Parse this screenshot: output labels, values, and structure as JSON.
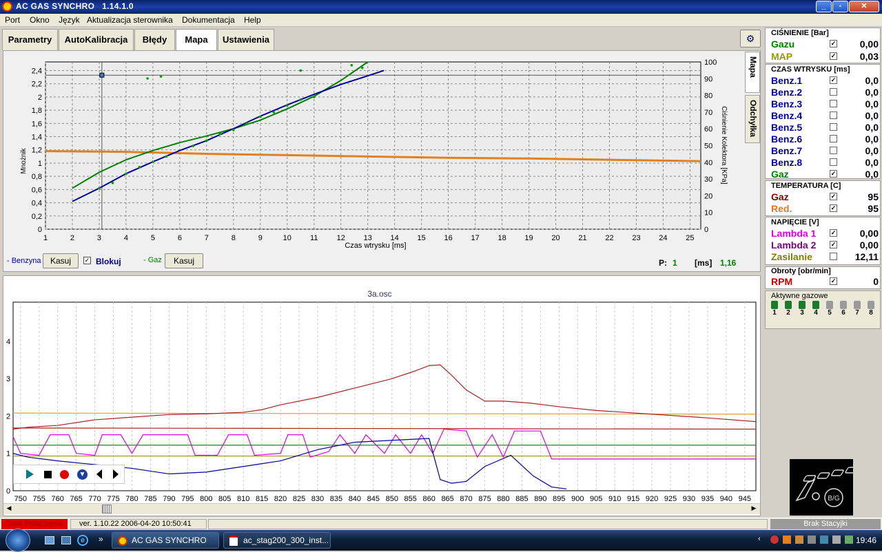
{
  "window": {
    "title": "AC GAS SYNCHRO",
    "version": "1.14.1.0"
  },
  "menu": [
    "Port",
    "Okno",
    "Język",
    "Aktualizacja sterownika",
    "Dokumentacja",
    "Help"
  ],
  "tabs": [
    "Parametry",
    "AutoKalibracja",
    "Błędy",
    "Mapa",
    "Ustawienia"
  ],
  "side_tabs": [
    "Mapa",
    "Odchyłka"
  ],
  "map_chart": {
    "xlabel": "Czas wtrysku [ms]",
    "ylabel": "Mnożnik",
    "y2label": "Ciśnienie Kolektora [KPa]",
    "x_ticks": [
      "1",
      "2",
      "3",
      "4",
      "5",
      "6",
      "7",
      "8",
      "9",
      "10",
      "11",
      "12",
      "13",
      "14",
      "15",
      "16",
      "17",
      "18",
      "19",
      "20",
      "21",
      "22",
      "23",
      "24",
      "25"
    ],
    "y_ticks": [
      "0",
      "0,2",
      "0,4",
      "0,6",
      "0,8",
      "1",
      "1,2",
      "1,4",
      "1,6",
      "1,8",
      "2",
      "2,2",
      "2,4"
    ],
    "y2_ticks": [
      "0",
      "10",
      "20",
      "30",
      "40",
      "50",
      "60",
      "70",
      "80",
      "90",
      "100"
    ]
  },
  "map_controls": {
    "benzyna_label": "- Benzyna",
    "kasuj1": "Kasuj",
    "blokuj": "Blokuj",
    "gaz_label": "- Gaz",
    "kasuj2": "Kasuj",
    "p_label": "P:",
    "p_value": "1",
    "ms_label": "[ms]",
    "ms_value": "1,16"
  },
  "osc": {
    "title": "3a.osc",
    "y_ticks": [
      "0",
      "1",
      "2",
      "3",
      "4"
    ],
    "x_ticks": [
      "750",
      "755",
      "760",
      "765",
      "770",
      "775",
      "780",
      "785",
      "790",
      "795",
      "800",
      "805",
      "810",
      "815",
      "820",
      "825",
      "830",
      "835",
      "840",
      "845",
      "850",
      "855",
      "860",
      "865",
      "870",
      "875",
      "880",
      "885",
      "890",
      "895",
      "900",
      "905",
      "910",
      "915",
      "920",
      "925",
      "930",
      "935",
      "940",
      "945"
    ]
  },
  "pressure": {
    "header": "CIŚNIENIE [Bar]",
    "rows": [
      {
        "label": "Gazu",
        "color": "#008000",
        "checked": true,
        "value": "0,00"
      },
      {
        "label": "MAP",
        "color": "#999900",
        "checked": true,
        "value": "0,03"
      }
    ]
  },
  "injection": {
    "header": "CZAS WTRYSKU  [ms]",
    "rows": [
      {
        "label": "Benz.1",
        "color": "#000099",
        "checked": true,
        "value": "0,0"
      },
      {
        "label": "Benz.2",
        "color": "#000099",
        "checked": false,
        "value": "0,0"
      },
      {
        "label": "Benz.3",
        "color": "#000099",
        "checked": false,
        "value": "0,0"
      },
      {
        "label": "Benz.4",
        "color": "#000099",
        "checked": false,
        "value": "0,0"
      },
      {
        "label": "Benz.5",
        "color": "#000099",
        "checked": false,
        "value": "0,0"
      },
      {
        "label": "Benz.6",
        "color": "#000099",
        "checked": false,
        "value": "0,0"
      },
      {
        "label": "Benz.7",
        "color": "#000099",
        "checked": false,
        "value": "0,0"
      },
      {
        "label": "Benz.8",
        "color": "#000099",
        "checked": false,
        "value": "0,0"
      },
      {
        "label": "Gaz",
        "color": "#008000",
        "checked": true,
        "value": "0,0"
      }
    ]
  },
  "temperature": {
    "header": "TEMPERATURA  [C]",
    "rows": [
      {
        "label": "Gaz",
        "color": "#800000",
        "checked": true,
        "value": "95"
      },
      {
        "label": "Red.",
        "color": "#e07820",
        "checked": true,
        "value": "95"
      }
    ]
  },
  "voltage": {
    "header": "NAPIĘCIE [V]",
    "rows": [
      {
        "label": "Lambda 1",
        "color": "#e000e0",
        "checked": true,
        "value": "0,00"
      },
      {
        "label": "Lambda 2",
        "color": "#800080",
        "checked": true,
        "value": "0,00"
      },
      {
        "label": "Zasilanie",
        "color": "#808000",
        "checked": false,
        "value": "12,11"
      }
    ]
  },
  "rpm": {
    "header": "Obroty [obr/min]",
    "rows": [
      {
        "label": "RPM",
        "color": "#cc0000",
        "checked": true,
        "value": "0"
      }
    ]
  },
  "active_gas": {
    "header": "Aktywne gazowe",
    "numbers": [
      "1",
      "2",
      "3",
      "4",
      "5",
      "6",
      "7",
      "8"
    ]
  },
  "logo": {
    "text": "B/G"
  },
  "status": {
    "connection": "Brak Połączenia",
    "version": "ver. 1.10.22  2006-04-20  10:50:41",
    "station": "Brak Stacyjki"
  },
  "taskbar": {
    "app1": "AC GAS SYNCHRO",
    "app2": "ac_stag200_300_inst...",
    "clock": "19:46"
  }
}
